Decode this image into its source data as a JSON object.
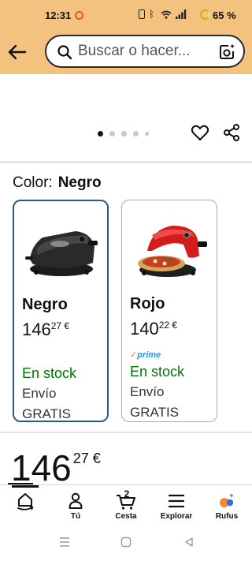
{
  "status_bar": {
    "time": "12:31",
    "battery": "65 %"
  },
  "search": {
    "placeholder": "Buscar o hacer..."
  },
  "gallery": {
    "dots": 5,
    "active_index": 0
  },
  "color_selector": {
    "label": "Color:",
    "selected": "Negro",
    "options": [
      {
        "name": "Negro",
        "price_whole": "146",
        "price_fraction": "27 €",
        "prime": false,
        "stock": "En stock",
        "shipping": "Envío",
        "shipping_more": "GRATIS"
      },
      {
        "name": "Rojo",
        "price_whole": "140",
        "price_fraction": "22 €",
        "prime": true,
        "prime_label": "prime",
        "stock": "En stock",
        "shipping": "Envío",
        "shipping_more": "GRATIS"
      }
    ]
  },
  "price": {
    "whole": "146",
    "fraction": "27 €"
  },
  "bottom_nav": {
    "items": [
      {
        "label": "",
        "icon": "home-icon"
      },
      {
        "label": "Tú",
        "icon": "user-icon"
      },
      {
        "label": "Cesta",
        "icon": "cart-icon",
        "badge": "2"
      },
      {
        "label": "Explorar",
        "icon": "menu-icon"
      },
      {
        "label": "Rufus",
        "icon": "rufus-icon"
      }
    ]
  },
  "colors": {
    "header_bg": "#f3c27f",
    "in_stock": "#007600",
    "selected_border": "#2a5b84",
    "prime_blue": "#1a98ff"
  }
}
